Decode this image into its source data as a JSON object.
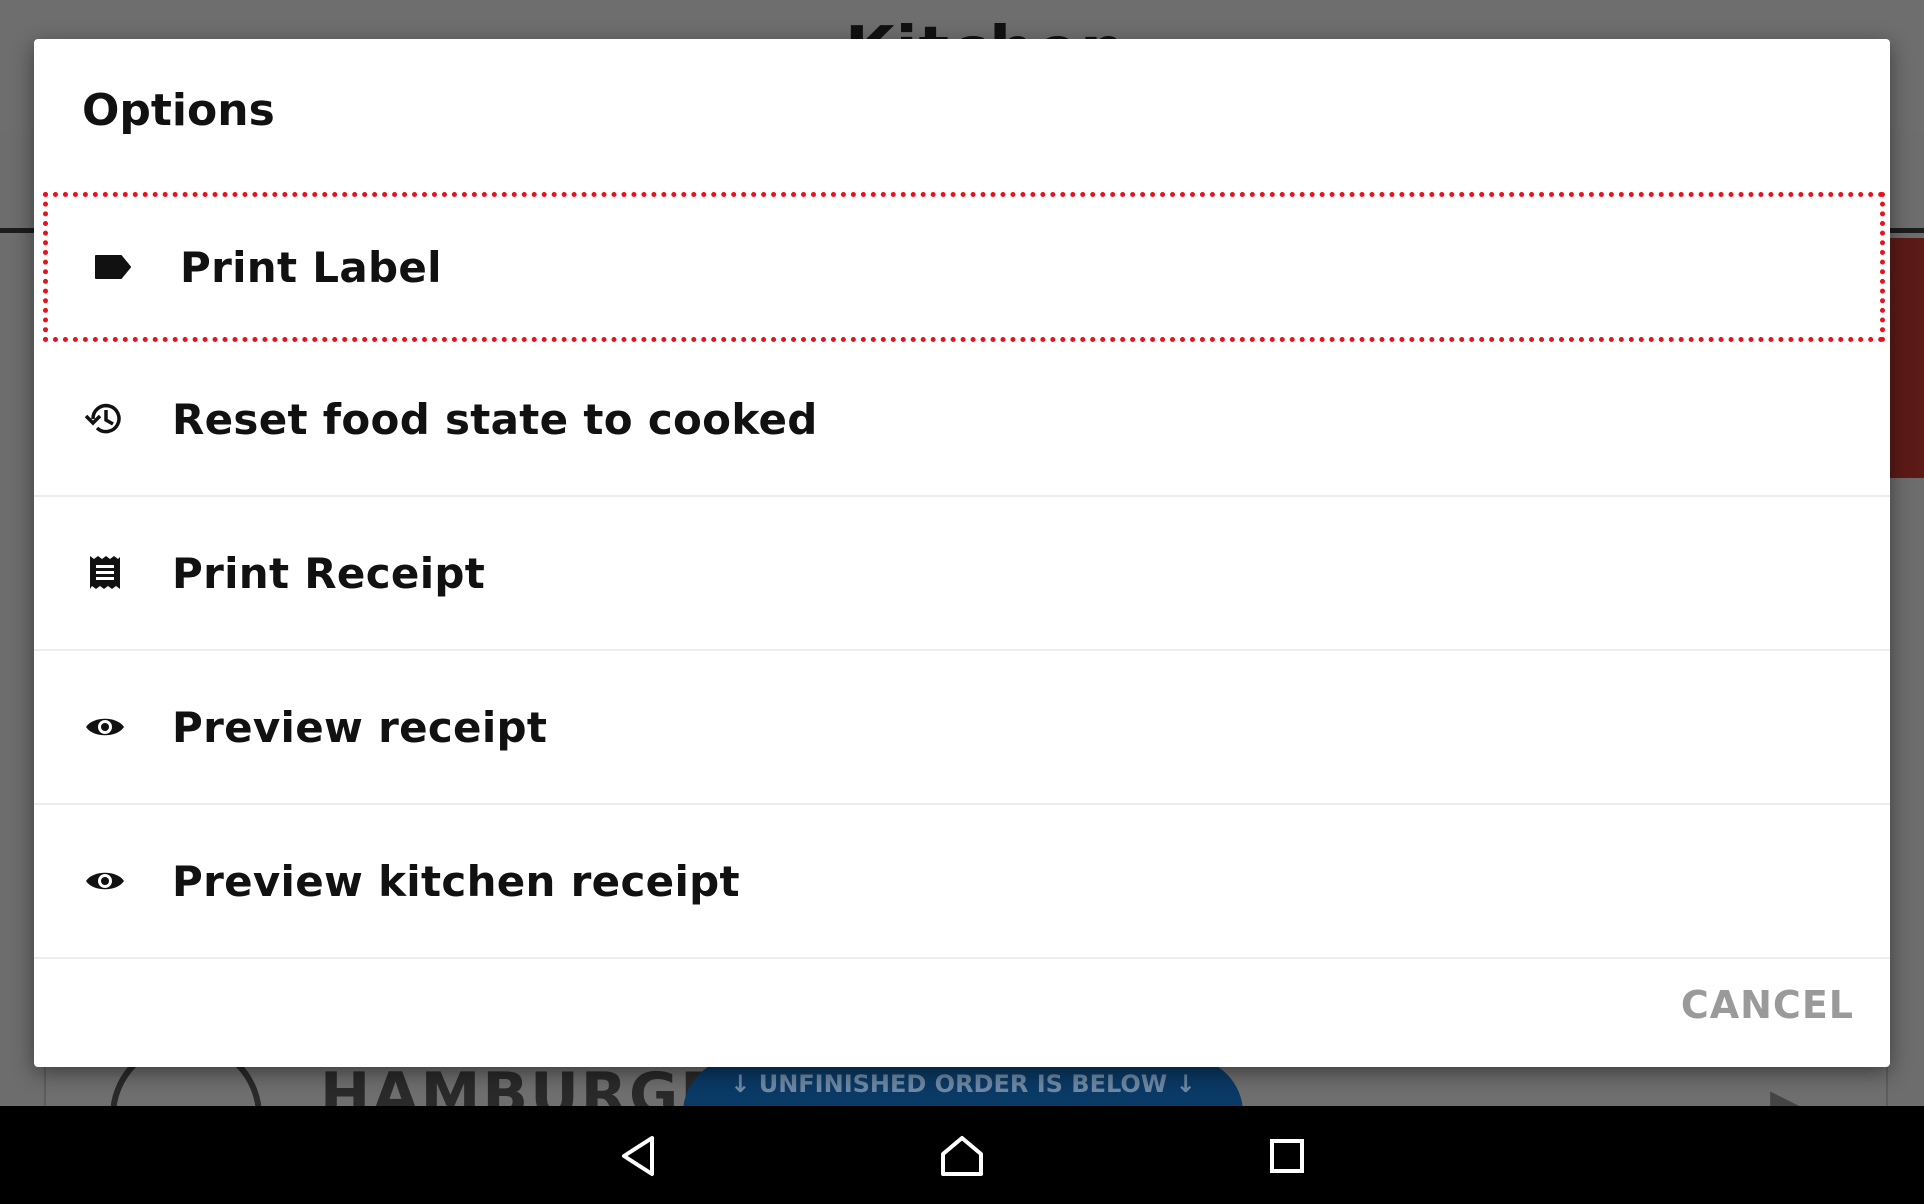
{
  "background": {
    "app_title": "Kitchen",
    "order_pill": "↓ UNFINISHED ORDER IS BELOW ↓",
    "item_name": "HAMBURGER",
    "item_progress": "0%"
  },
  "dialog": {
    "title": "Options",
    "items": [
      {
        "label": "Print Label",
        "icon": "label-icon"
      },
      {
        "label": "Reset food state to cooked",
        "icon": "history-icon"
      },
      {
        "label": "Print Receipt",
        "icon": "receipt-icon"
      },
      {
        "label": "Preview receipt",
        "icon": "eye-icon"
      },
      {
        "label": "Preview kitchen receipt",
        "icon": "eye-icon"
      }
    ],
    "cancel_label": "CANCEL"
  },
  "navbar": {
    "back": "back-icon",
    "home": "home-icon",
    "recents": "recents-icon"
  },
  "colors": {
    "highlight": "#e8121c",
    "overlay": "#6d6d6d",
    "cancel": "#9a9a9a"
  }
}
